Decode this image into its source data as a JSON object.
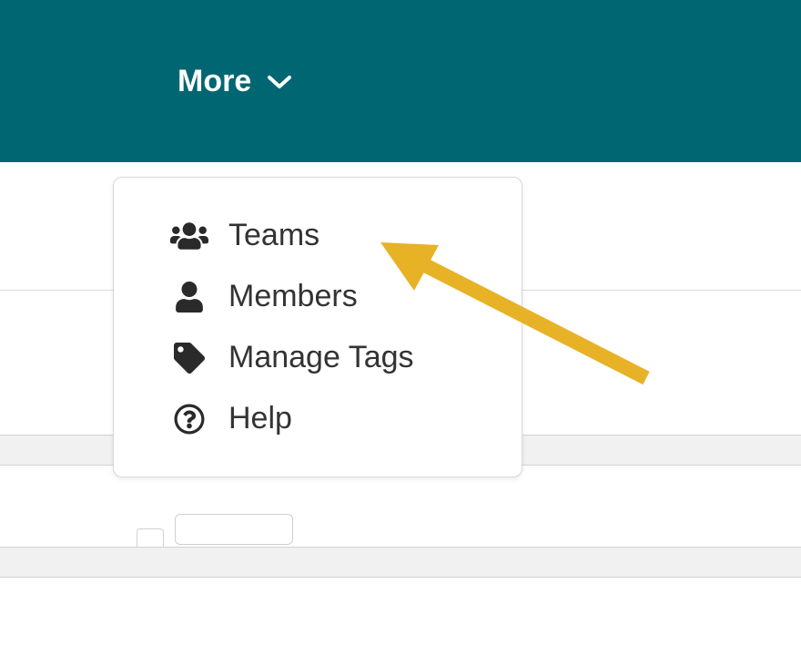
{
  "navbar": {
    "more_label": "More"
  },
  "menu": {
    "items": [
      {
        "label": "Teams"
      },
      {
        "label": "Members"
      },
      {
        "label": "Manage Tags"
      },
      {
        "label": "Help"
      }
    ]
  },
  "colors": {
    "navbar_bg": "#006672",
    "arrow": "#E8B227"
  }
}
